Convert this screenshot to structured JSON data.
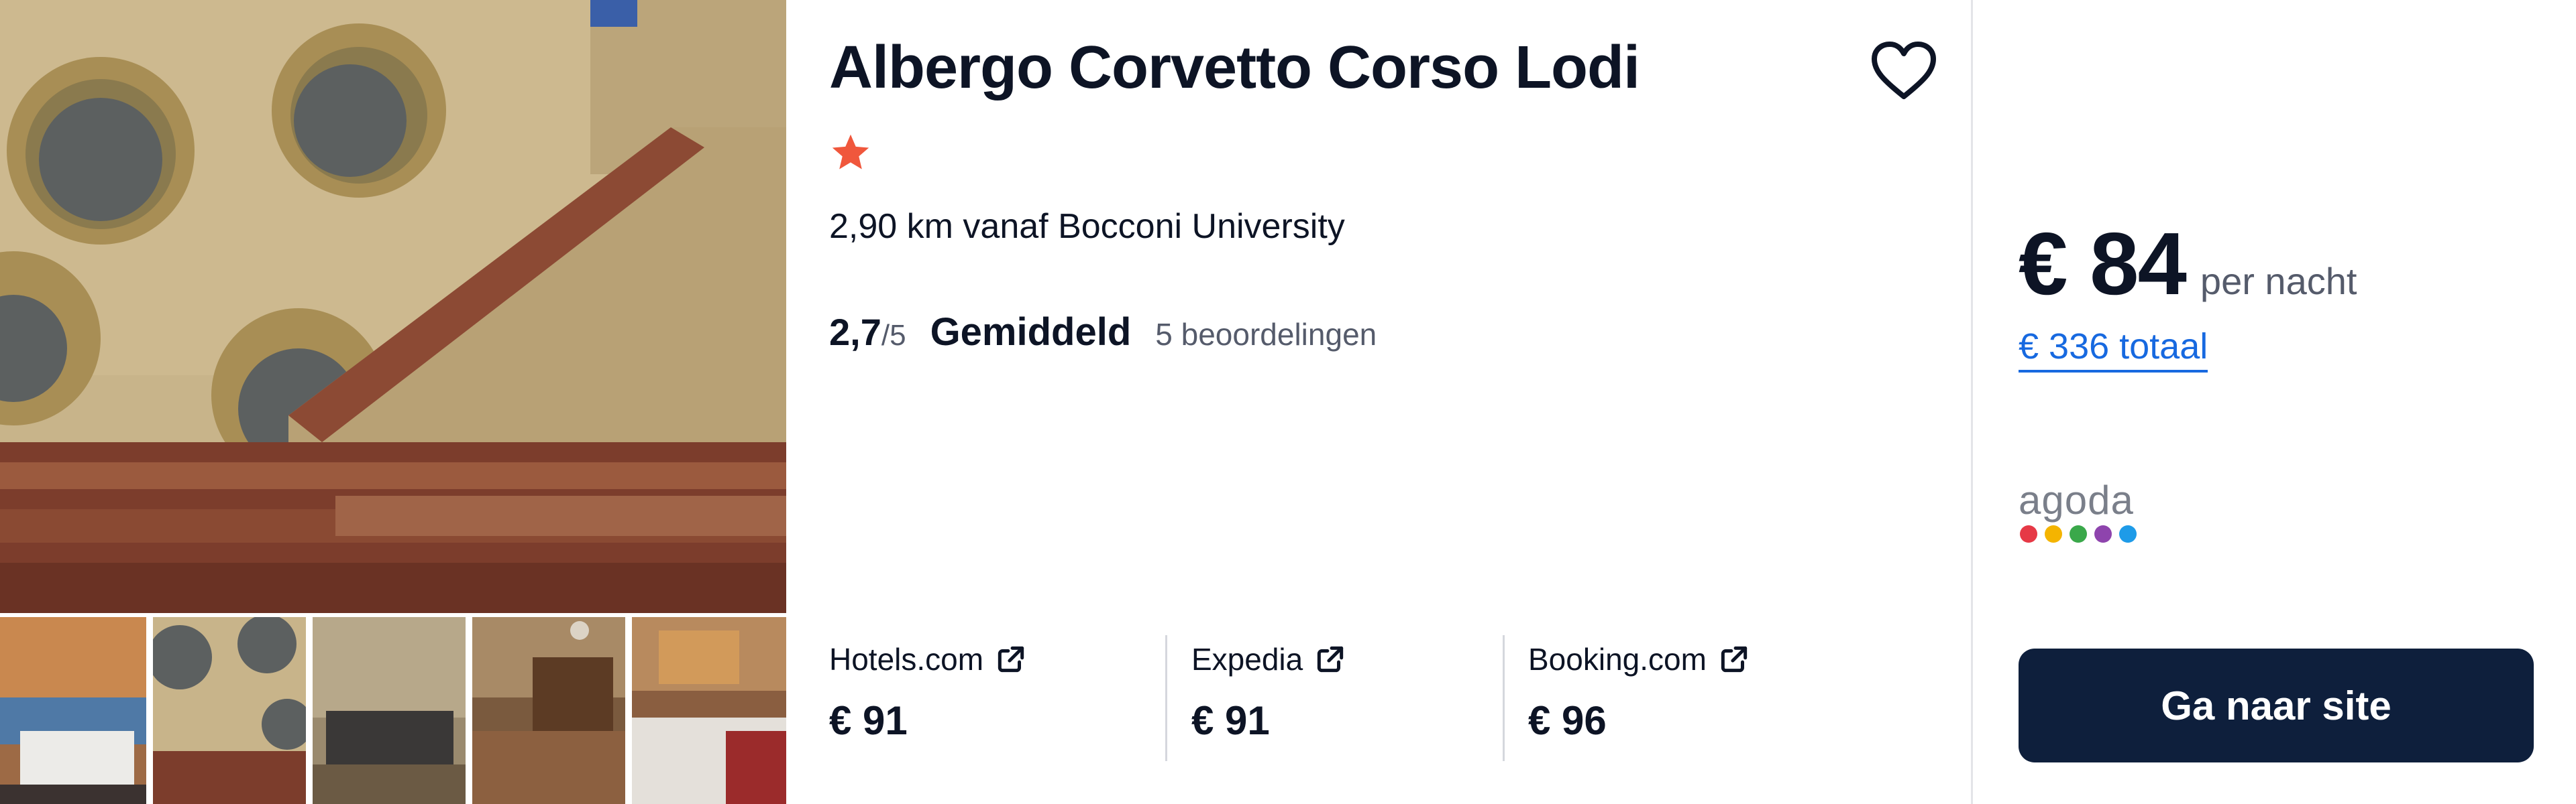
{
  "hotel": {
    "name": "Albergo Corvetto Corso Lodi",
    "star_count": 1,
    "distance": "2,90 km vanaf Bocconi University",
    "rating": {
      "score": "2,7",
      "max": "/5",
      "label": "Gemiddeld",
      "reviews": "5 beoordelingen"
    }
  },
  "providers": [
    {
      "name": "Hotels.com",
      "price": "€ 91",
      "icon": "external-link-icon"
    },
    {
      "name": "Expedia",
      "price": "€ 91",
      "icon": "external-link-icon"
    },
    {
      "name": "Booking.com",
      "price": "€ 96",
      "icon": "external-link-icon"
    }
  ],
  "offer": {
    "price": "€ 84",
    "per_night": "per nacht",
    "total": "€ 336 totaal",
    "provider_logo": "agoda",
    "cta_label": "Ga naar site"
  },
  "colors": {
    "star": "#f0573c",
    "link": "#1769e0",
    "cta_background": "#0e1f3c",
    "agoda_dots": [
      "#e63946",
      "#f4b400",
      "#3aa84a",
      "#8e44ad",
      "#1e9be8"
    ]
  },
  "icons": {
    "favorite": "heart-outline-icon",
    "star": "star-icon"
  }
}
